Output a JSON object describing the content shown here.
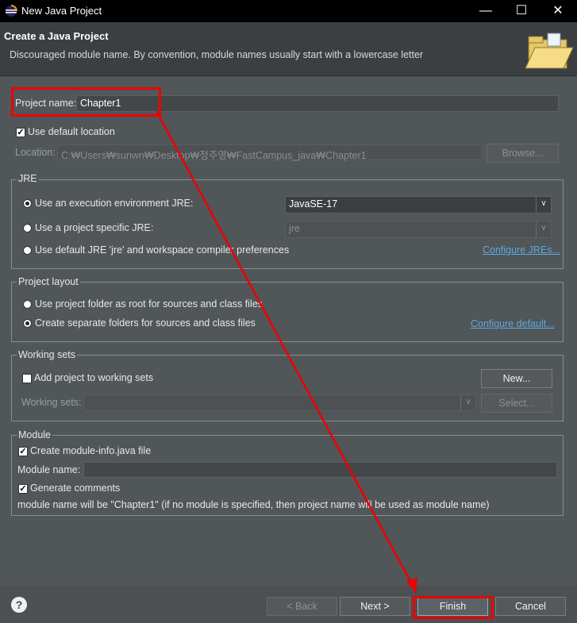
{
  "window": {
    "title": "New Java Project"
  },
  "header": {
    "title": "Create a Java Project",
    "message": "Discouraged module name. By convention, module names usually start with a lowercase letter"
  },
  "project": {
    "name_label": "Project name:",
    "name_value": "Chapter1",
    "use_default_location_label": "Use default location",
    "use_default_location_checked": true,
    "location_label": "Location:",
    "location_value": "C:₩Users₩sunwn₩Desktop₩정주영₩FastCampus_java₩Chapter1",
    "browse_label": "Browse..."
  },
  "jre": {
    "group_label": "JRE",
    "options": [
      {
        "label": "Use an execution environment JRE:",
        "selected": true,
        "value": "JavaSE-17"
      },
      {
        "label": "Use a project specific JRE:",
        "selected": false,
        "value": "jre"
      },
      {
        "label": "Use default JRE 'jre' and workspace compiler preferences",
        "selected": false
      }
    ],
    "configure_link": "Configure JREs..."
  },
  "layout": {
    "group_label": "Project layout",
    "options": [
      {
        "label": "Use project folder as root for sources and class files",
        "selected": false
      },
      {
        "label": "Create separate folders for sources and class files",
        "selected": true
      }
    ],
    "configure_link": "Configure default..."
  },
  "working_sets": {
    "group_label": "Working sets",
    "add_label": "Add project to working sets",
    "add_checked": false,
    "new_button": "New...",
    "sets_label": "Working sets:",
    "select_button": "Select..."
  },
  "module": {
    "group_label": "Module",
    "create_label": "Create module-info.java file",
    "create_checked": true,
    "name_label": "Module name:",
    "generate_label": "Generate comments",
    "generate_checked": true,
    "info": "module name will be \"Chapter1\"  (if no module is specified, then project name will be used as module name)"
  },
  "footer": {
    "back": "< Back",
    "next": "Next >",
    "finish": "Finish",
    "cancel": "Cancel"
  },
  "annotation_color": "#e00000"
}
